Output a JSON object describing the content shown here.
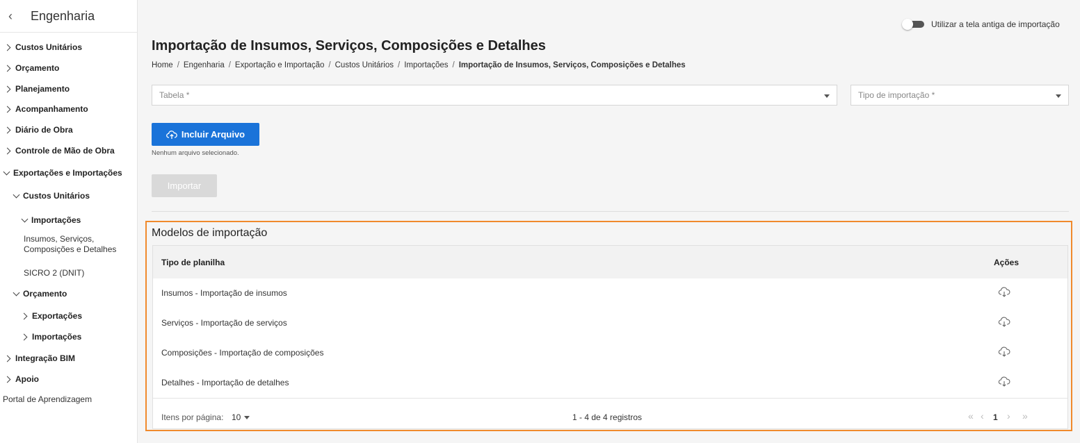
{
  "sidebar": {
    "title": "Engenharia",
    "items": [
      {
        "label": "Custos Unitários"
      },
      {
        "label": "Orçamento"
      },
      {
        "label": "Planejamento"
      },
      {
        "label": "Acompanhamento"
      },
      {
        "label": "Diário de Obra"
      },
      {
        "label": "Controle de Mão de Obra"
      },
      {
        "label": "Exportações e Importações"
      },
      {
        "label": "Custos Unitários"
      },
      {
        "label": "Importações"
      },
      {
        "label": "Insumos, Serviços,"
      },
      {
        "label": "Composições e Detalhes"
      },
      {
        "label": "SICRO 2 (DNIT)"
      },
      {
        "label": "Orçamento"
      },
      {
        "label": "Exportações"
      },
      {
        "label": "Importações"
      },
      {
        "label": "Integração BIM"
      },
      {
        "label": "Apoio"
      },
      {
        "label": "Portal de Aprendizagem"
      }
    ]
  },
  "toggle": {
    "label": "Utilizar a tela antiga de importação",
    "checked": false
  },
  "page": {
    "title": "Importação de Insumos, Serviços, Composições e Detalhes",
    "breadcrumb": [
      "Home",
      "Engenharia",
      "Exportação e Importação",
      "Custos Unitários",
      "Importações",
      "Importação de Insumos, Serviços, Composições e Detalhes"
    ]
  },
  "form": {
    "tabela_placeholder": "Tabela *",
    "tipo_placeholder": "Tipo de importação *",
    "upload_label": "Incluir Arquivo",
    "no_file": "Nenhum arquivo selecionado.",
    "import_label": "Importar"
  },
  "models": {
    "title": "Modelos de importação",
    "col_tipo": "Tipo de planilha",
    "col_acoes": "Ações",
    "rows": [
      {
        "label": "Insumos - Importação de insumos"
      },
      {
        "label": "Serviços - Importação de serviços"
      },
      {
        "label": "Composições - Importação de composições"
      },
      {
        "label": "Detalhes - Importação de detalhes"
      }
    ],
    "per_page_label": "Itens por página:",
    "per_page_value": "10",
    "range": "1 - 4 de 4 registros",
    "page": "1"
  },
  "colors": {
    "accent": "#1a73d9",
    "highlight": "#f08a2c"
  }
}
